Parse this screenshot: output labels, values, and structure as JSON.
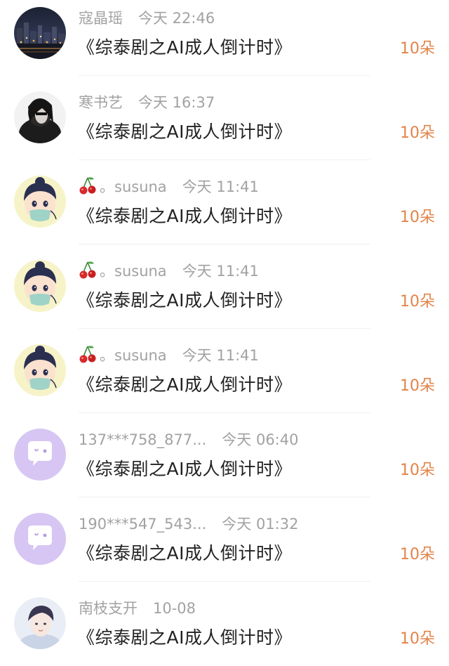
{
  "colors": {
    "username": "#a2a2a2",
    "title": "#222222",
    "count": "#e2844a",
    "divider": "#f0f0f0",
    "default_avatar_bg": "#d7c6f3"
  },
  "items": [
    {
      "name": "寇晶瑶",
      "time": "今天 22:46",
      "title": "《综泰剧之AI成人倒计时》",
      "count": "10朵",
      "avatar": "city-night-photo",
      "name_icon": ""
    },
    {
      "name": "寒书艺",
      "time": "今天 16:37",
      "title": "《综泰剧之AI成人倒计时》",
      "count": "10朵",
      "avatar": "portrait-photo-dark",
      "name_icon": ""
    },
    {
      "name": "。susuna",
      "time": "今天 11:41",
      "title": "《综泰剧之AI成人倒计时》",
      "count": "10朵",
      "avatar": "cartoon-boy-mask",
      "name_icon": "cherry-icon"
    },
    {
      "name": "。susuna",
      "time": "今天 11:41",
      "title": "《综泰剧之AI成人倒计时》",
      "count": "10朵",
      "avatar": "cartoon-boy-mask",
      "name_icon": "cherry-icon"
    },
    {
      "name": "。susuna",
      "time": "今天 11:41",
      "title": "《综泰剧之AI成人倒计时》",
      "count": "10朵",
      "avatar": "cartoon-boy-mask",
      "name_icon": "cherry-icon"
    },
    {
      "name": "137***758_877...",
      "time": "今天 06:40",
      "title": "《综泰剧之AI成人倒计时》",
      "count": "10朵",
      "avatar": "default-chat-bubble-icon",
      "name_icon": ""
    },
    {
      "name": "190***547_543...",
      "time": "今天 01:32",
      "title": "《综泰剧之AI成人倒计时》",
      "count": "10朵",
      "avatar": "default-chat-bubble-icon",
      "name_icon": ""
    },
    {
      "name": "南枝支开",
      "time": "10-08",
      "title": "《综泰剧之AI成人倒计时》",
      "count": "10朵",
      "avatar": "portrait-photo-light",
      "name_icon": ""
    }
  ]
}
